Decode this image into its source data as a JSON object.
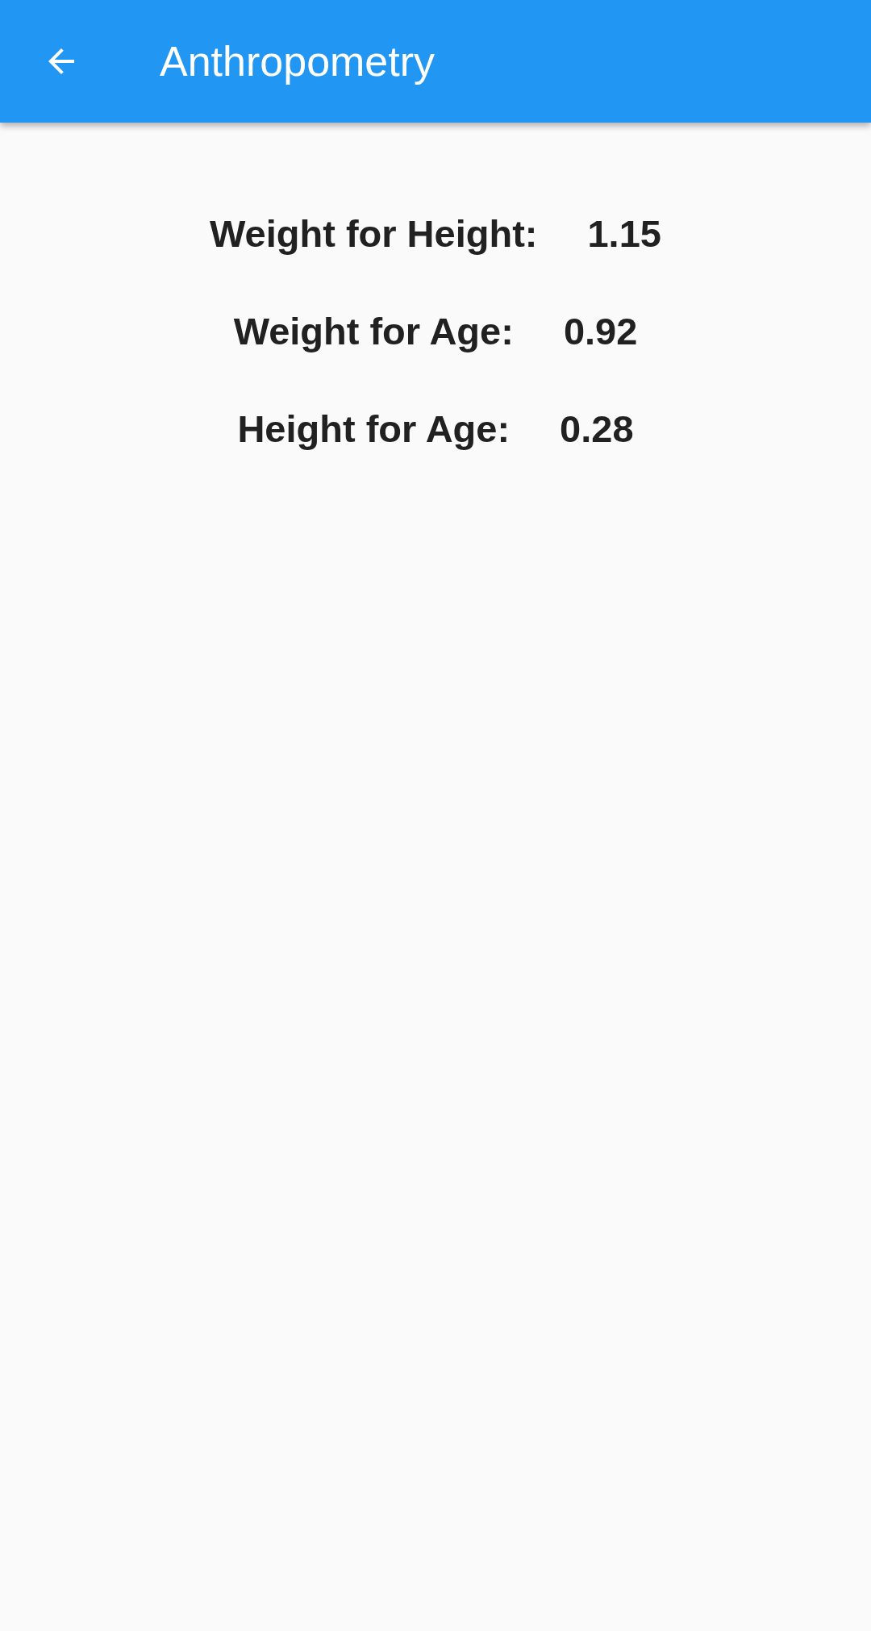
{
  "app_bar": {
    "title": "Anthropometry"
  },
  "rows": [
    {
      "label": "Weight for Height:",
      "value": "1.15"
    },
    {
      "label": "Weight for Age:",
      "value": "0.92"
    },
    {
      "label": "Height for Age:",
      "value": "0.28"
    }
  ]
}
